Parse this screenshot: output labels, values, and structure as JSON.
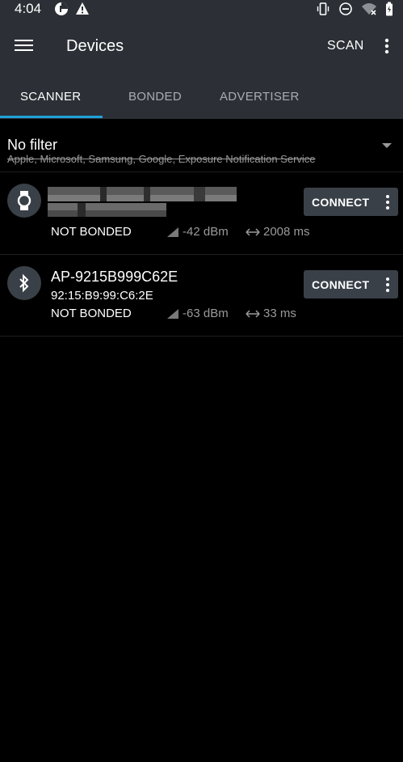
{
  "status_bar": {
    "time": "4:04",
    "left_icons": [
      "data-saver-icon",
      "warning-icon"
    ],
    "right_icons": [
      "vibrate-icon",
      "do-not-disturb-icon",
      "wifi-off-icon",
      "battery-icon"
    ]
  },
  "app_bar": {
    "title": "Devices",
    "scan_label": "SCAN"
  },
  "tabs": [
    {
      "label": "SCANNER",
      "active": true
    },
    {
      "label": "BONDED",
      "active": false
    },
    {
      "label": "ADVERTISER",
      "active": false
    }
  ],
  "filter": {
    "title": "No filter",
    "subtitle": "Apple, Microsoft, Samsung, Google, Exposure Notification Service"
  },
  "devices": [
    {
      "icon": "watch-icon",
      "name": "",
      "address": "",
      "bond_state": "NOT BONDED",
      "rssi": "-42 dBm",
      "interval": "2008 ms",
      "connect_label": "CONNECT"
    },
    {
      "icon": "bluetooth-icon",
      "name": "AP-9215B999C62E",
      "address": "92:15:B9:99:C6:2E",
      "bond_state": "NOT BONDED",
      "rssi": "-63 dBm",
      "interval": "33 ms",
      "connect_label": "CONNECT"
    }
  ],
  "colors": {
    "toolbar": "#2c3036",
    "accent": "#1fa2d9",
    "button": "#3a4048"
  }
}
